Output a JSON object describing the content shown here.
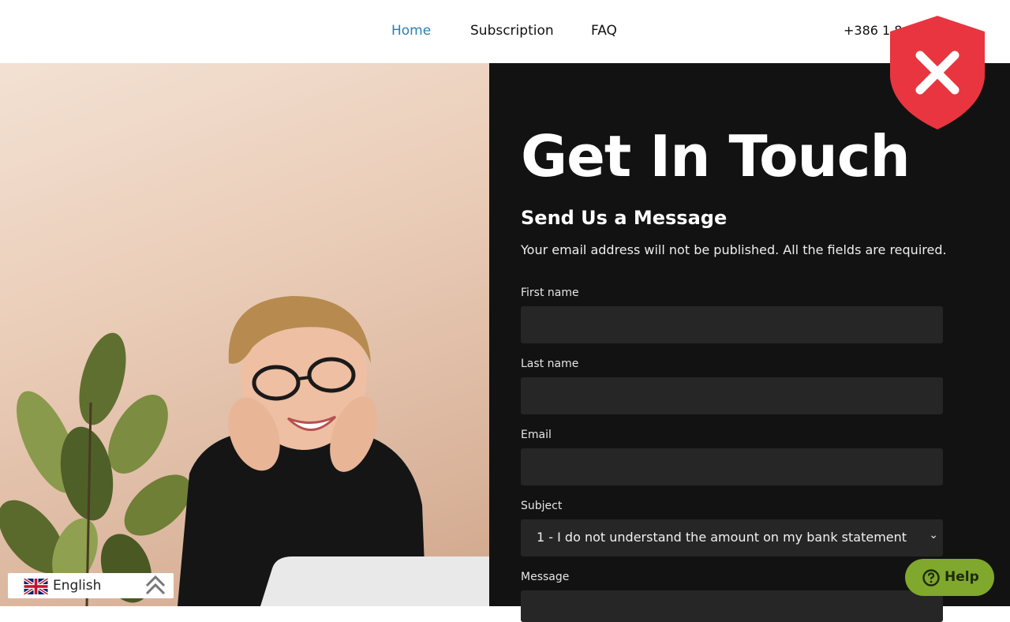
{
  "header": {
    "nav": [
      {
        "label": "Home",
        "active": true
      },
      {
        "label": "Subscription",
        "active": false
      },
      {
        "label": "FAQ",
        "active": false
      }
    ],
    "phone": "+386 1 8"
  },
  "contact": {
    "title": "Get In Touch",
    "subtitle": "Send Us a Message",
    "note": "Your email address will not be published. All the fields are required.",
    "fields": {
      "first_name": {
        "label": "First name",
        "value": ""
      },
      "last_name": {
        "label": "Last name",
        "value": ""
      },
      "email": {
        "label": "Email",
        "value": ""
      },
      "subject": {
        "label": "Subject",
        "selected": "1 - I do not understand the amount on my bank statement"
      },
      "message": {
        "label": "Message",
        "value": ""
      }
    }
  },
  "language": {
    "label": "English",
    "flag_icon": "uk-flag-icon",
    "toggle_icon": "double-chevron-up-icon"
  },
  "help": {
    "label": "Help",
    "icon": "question-circle-icon",
    "color": "#7fa82d"
  },
  "badge": {
    "icon": "shield-x-icon",
    "color": "#e8353f"
  },
  "colors": {
    "active_nav": "#2a7fb8",
    "panel_bg": "#121212",
    "input_bg": "#262626"
  }
}
